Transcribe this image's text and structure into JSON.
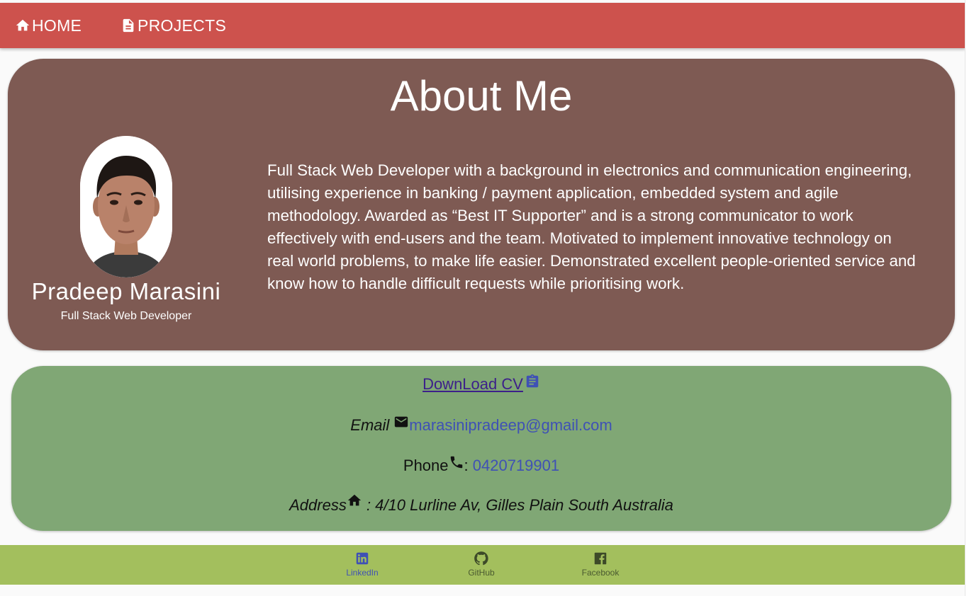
{
  "nav": {
    "home_label": "HOME",
    "projects_label": "PROJECTS",
    "home_icon": "home-icon",
    "projects_icon": "document-icon"
  },
  "about": {
    "title": "About Me",
    "name": "Pradeep Marasini",
    "role": "Full Stack Web Developer",
    "bio": "Full Stack Web Developer with a background in electronics and communication engineering, utilising experience in banking / payment application, embedded system and agile methodology. Awarded as “Best IT Supporter” and is a strong communicator to work effectively with end-users and the team. Motivated to implement innovative technology on real world problems, to make life easier. Demonstrated excellent people-oriented service and know how to handle difficult requests while prioritising work."
  },
  "contact": {
    "cv_label": "DownLoad CV ",
    "email_label": "Email",
    "email_value": "marasinipradeep@gmail.com",
    "phone_label": "Phone",
    "phone_sep": ": ",
    "phone_value": "0420719901",
    "address_label": "Address",
    "address_value": " : 4/10 Lurline Av, Gilles Plain South Australia"
  },
  "footer": {
    "linkedin": "LinkedIn",
    "github": "GitHub",
    "facebook": "Facebook"
  },
  "colors": {
    "navbar": "#cd524d",
    "about_card": "#7e5a53",
    "contact_card": "#80a775",
    "footer": "#a3bf5d",
    "link": "#3f51b5"
  }
}
